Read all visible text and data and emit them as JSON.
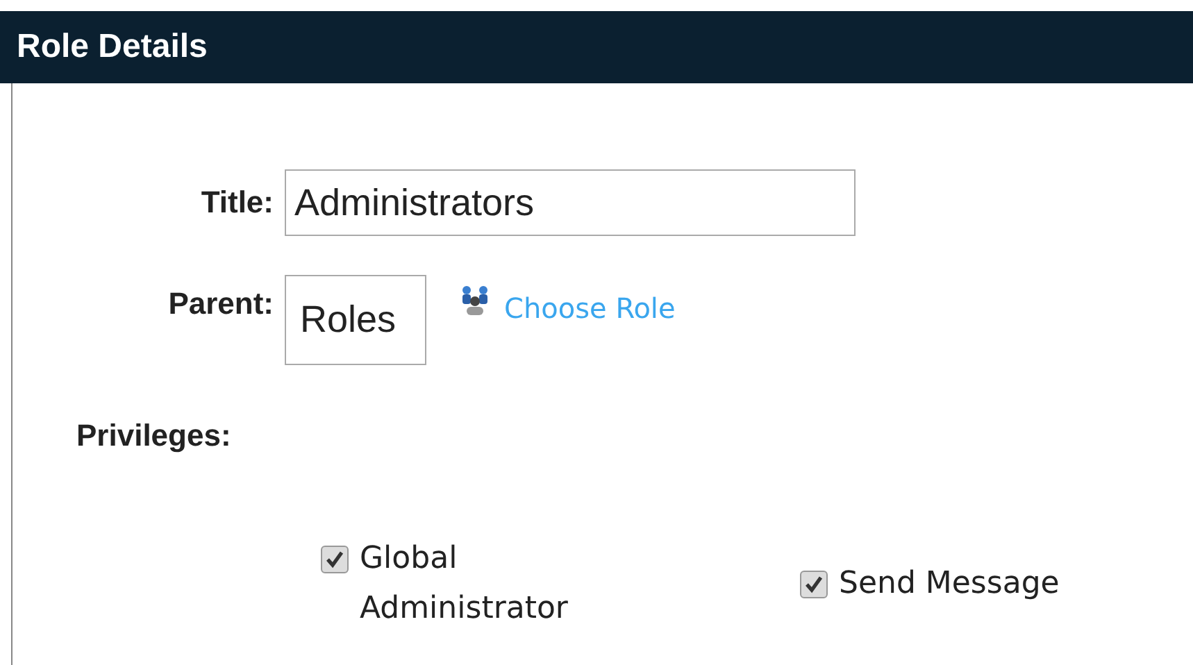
{
  "panel": {
    "title": "Role Details"
  },
  "form": {
    "title_label": "Title:",
    "title_value": "Administrators",
    "parent_label": "Parent:",
    "parent_value": "Roles",
    "choose_link": "Choose Role",
    "privileges_label": "Privileges:"
  },
  "privileges": [
    {
      "label": "Global Administrator",
      "checked": true
    },
    {
      "label": "Send Message",
      "checked": true
    }
  ]
}
